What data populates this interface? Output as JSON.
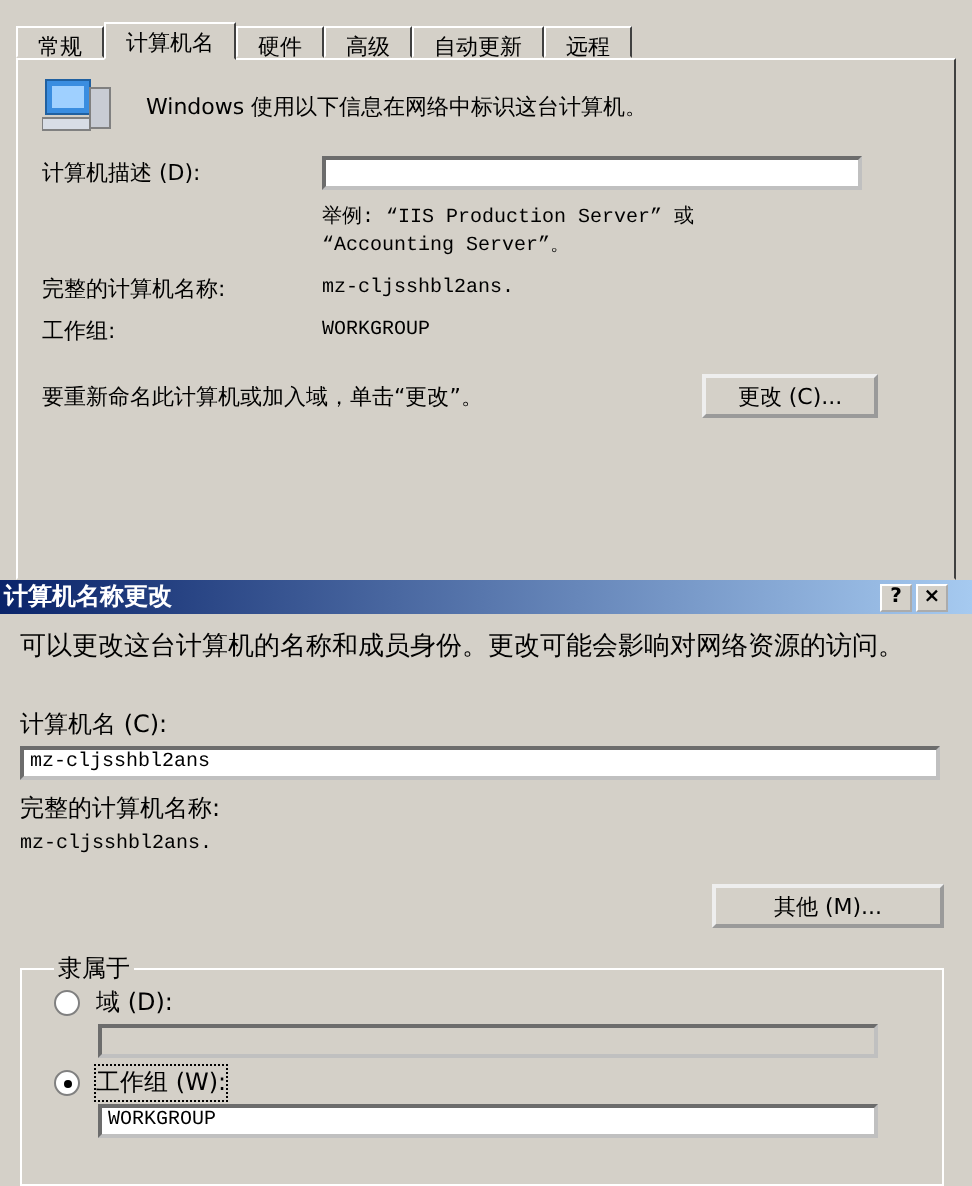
{
  "properties": {
    "tabs": [
      {
        "label": "常规",
        "selected": false
      },
      {
        "label": "计算机名",
        "selected": true
      },
      {
        "label": "硬件",
        "selected": false
      },
      {
        "label": "高级",
        "selected": false
      },
      {
        "label": "自动更新",
        "selected": false
      },
      {
        "label": "远程",
        "selected": false
      }
    ],
    "intro": "Windows 使用以下信息在网络中标识这台计算机。",
    "description": {
      "label": "计算机描述 (D):",
      "example": "举例: “IIS Production Server” 或 “Accounting Server”。"
    },
    "info": [
      {
        "label": "完整的计算机名称:",
        "value": "mz-cljsshbl2ans."
      },
      {
        "label": "工作组:",
        "value": "WORKGROUP"
      }
    ],
    "rename_prompt": "要重新命名此计算机或加入域，单击“更改”。",
    "change_button": "更改 (C)..."
  },
  "dialog": {
    "title": "计算机名称更改",
    "help_button": "?",
    "close_button": "×",
    "intro": "可以更改这台计算机的名称和成员身份。更改可能会影响对网络资源的访问。",
    "name_label": "计算机名 (C):",
    "name_value": "mz-cljsshbl2ans",
    "full_name_label": "完整的计算机名称:",
    "full_name_value": "mz-cljsshbl2ans.",
    "other_button": "其他 (M)...",
    "member_of": {
      "title": "隶属于",
      "options": [
        {
          "label": "域 (D):",
          "selected": false
        },
        {
          "label": "工作组 (W):",
          "selected": true,
          "value": "WORKGROUP"
        }
      ]
    }
  }
}
